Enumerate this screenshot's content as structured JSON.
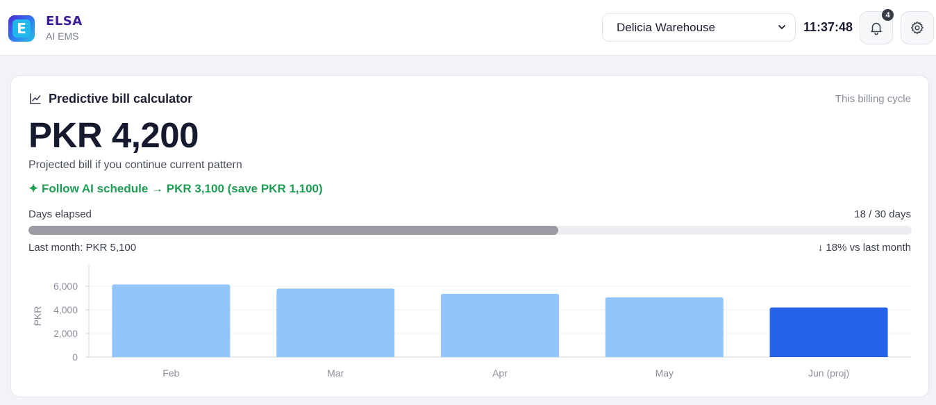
{
  "app": {
    "logo_letter": "E",
    "name": "ELSA",
    "subtitle": "AI EMS"
  },
  "header": {
    "site_selector": {
      "selected": "Delicia Warehouse"
    },
    "clock": "11:37:48",
    "notifications": {
      "count": "4"
    }
  },
  "card": {
    "title": "Predictive bill calculator",
    "period": "This billing cycle",
    "amount": "PKR 4,200",
    "caption": "Projected bill if you continue current pattern",
    "ai_schedule": "✦ Follow AI schedule → PKR 3,100 (save PKR 1,100)",
    "days_label": "Days elapsed",
    "days_value": "18 / 30 days",
    "days_progress": 0.6,
    "last_month": "Last month: PKR 5,100",
    "vs_last_month": "↓ 18% vs last month"
  },
  "colors": {
    "accent_green": "#1f9d55",
    "bar_history": "#93c5fb",
    "bar_projected": "#2563eb",
    "progress_fill": "#9b9ca3"
  },
  "chart_data": {
    "type": "bar",
    "categories": [
      "Feb",
      "Mar",
      "Apr",
      "May",
      "Jun (proj)"
    ],
    "values": [
      6150,
      5800,
      5350,
      5050,
      4200
    ],
    "highlight_index": 4,
    "ylabel": "PKR",
    "yticks": [
      "0",
      "2,000",
      "4,000",
      "6,000"
    ],
    "ytick_values": [
      0,
      2000,
      4000,
      6000
    ],
    "ylim": [
      0,
      7000
    ],
    "grid": true
  }
}
